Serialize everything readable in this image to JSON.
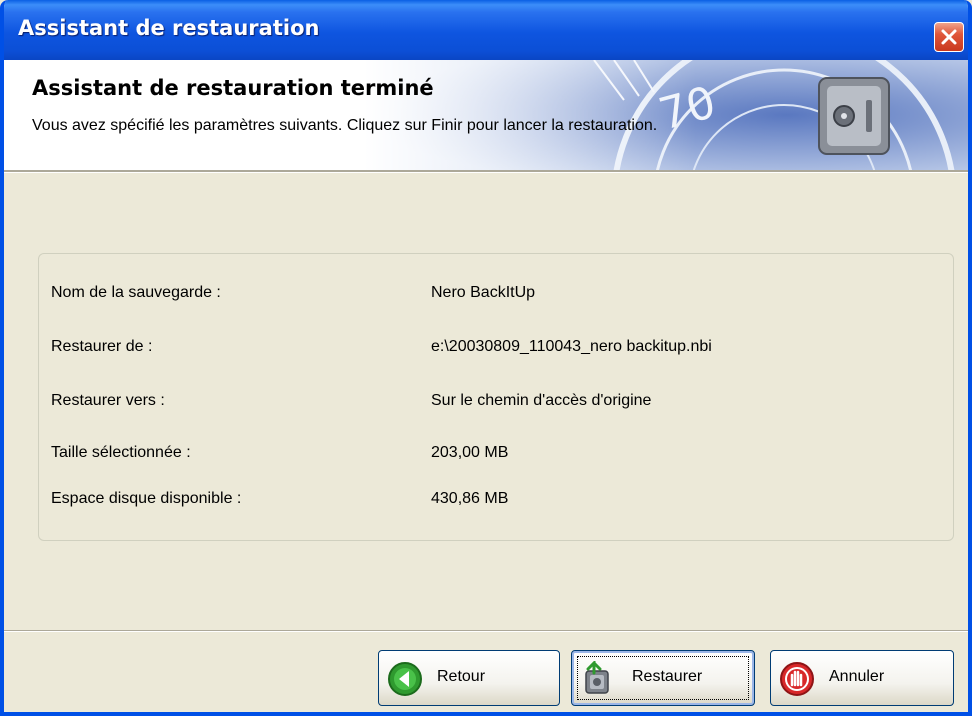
{
  "window": {
    "title": "Assistant de restauration",
    "close_icon": "close-icon"
  },
  "header": {
    "title": "Assistant de restauration terminé",
    "description": "Vous avez spécifié les paramètres suivants. Cliquez sur Finir pour lancer la restauration.",
    "art_icon": "safe-icon"
  },
  "summary": {
    "rows": [
      {
        "label": "Nom de la sauvegarde :",
        "value": "Nero BackItUp"
      },
      {
        "label": "Restaurer de :",
        "value": "e:\\20030809_110043_nero backitup.nbi"
      },
      {
        "label": "Restaurer vers :",
        "value": "Sur le chemin d'accès d'origine"
      },
      {
        "label": "Taille sélectionnée :",
        "value": "203,00 MB"
      },
      {
        "label": "Espace disque disponible :",
        "value": "430,86 MB"
      }
    ]
  },
  "buttons": {
    "back": {
      "label": "Retour",
      "icon": "back-arrow-icon"
    },
    "restore": {
      "label": "Restaurer",
      "icon": "restore-icon"
    },
    "cancel": {
      "label": "Annuler",
      "icon": "stop-hand-icon"
    }
  },
  "colors": {
    "titlebar": "#0c4fd6",
    "dialog_bg": "#ece9d8",
    "header_bg": "#ffffff",
    "close_button": "#e0563a",
    "button_border": "#003c74"
  }
}
